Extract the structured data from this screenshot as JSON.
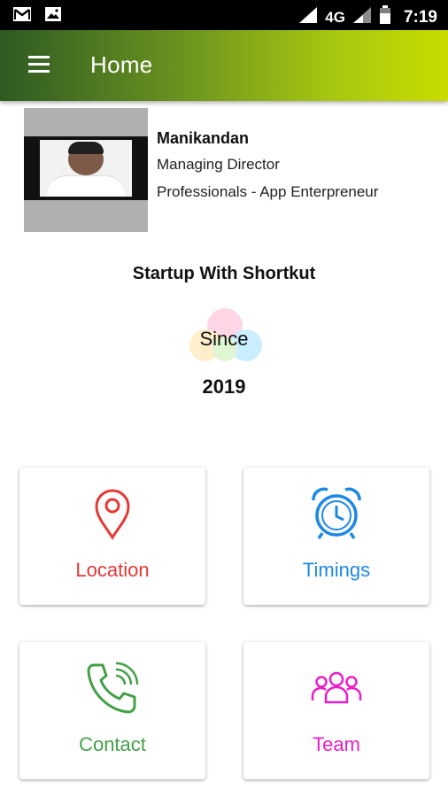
{
  "status_bar": {
    "network": "4G",
    "time": "7:19",
    "icons": [
      "gmail-icon",
      "image-icon",
      "signal-icon",
      "signal-icon",
      "battery-icon"
    ]
  },
  "app_bar": {
    "title": "Home",
    "menu_icon": "hamburger-menu-icon"
  },
  "profile": {
    "name": "Manikandan",
    "role": "Managing Director",
    "category": "Professionals - App Enterpreneur"
  },
  "tagline": "Startup With Shortkut",
  "since": {
    "label": "Since",
    "year": "2019"
  },
  "tiles": [
    {
      "label": "Location",
      "icon": "map-pin-icon",
      "color": "#e53935"
    },
    {
      "label": "Timings",
      "icon": "alarm-clock-icon",
      "color": "#1e88e5"
    },
    {
      "label": "Contact",
      "icon": "phone-ringing-icon",
      "color": "#43a047"
    },
    {
      "label": "Team",
      "icon": "team-icon",
      "color": "#e91ec9"
    }
  ],
  "colors": {
    "app_bar_gradient_start": "#2f5a22",
    "app_bar_gradient_end": "#c9db00"
  }
}
